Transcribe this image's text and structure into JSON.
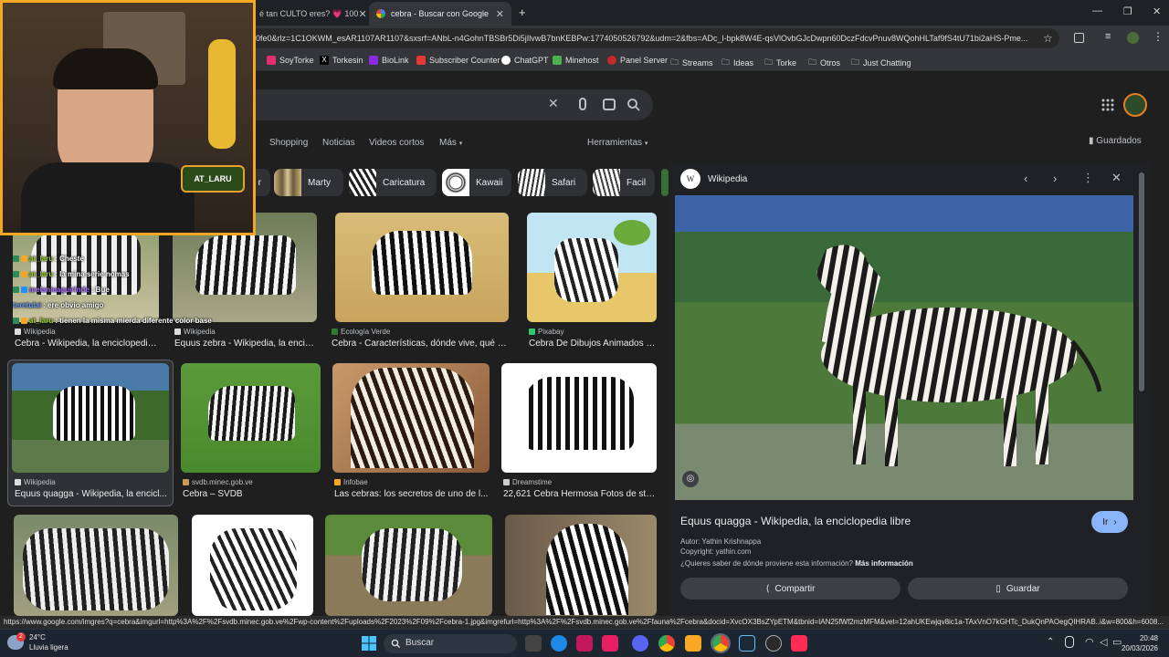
{
  "browser": {
    "tabs": [
      {
        "title": "é tan CULTO eres? 💗 100"
      },
      {
        "title": "cebra - Buscar con Google"
      }
    ],
    "new_tab_label": "+",
    "url": "0fe0&rlz=1C1OKWM_esAR1107AR1107&sxsrf=ANbL-n4GohnTBSBr5Di5jIlvwB7bnKEBPw:1774050526792&udm=2&fbs=ADc_l-bpk8W4E-qsVlOvbGJcDwpn60DczFdcvPnuv8WQohHLTaf9fS4tU71bi2aHS-Pme...",
    "bookmarks": [
      "SoyTorke",
      "Torkesin",
      "BioLink",
      "Subscriber Counter",
      "ChatGPT",
      "Minehost",
      "Panel Server",
      "Streams",
      "Ideas",
      "Torke",
      "Otros",
      "Just Chatting"
    ]
  },
  "google": {
    "filters": [
      "Shopping",
      "Noticias",
      "Videos cortos",
      "Más"
    ],
    "tools": "Herramientas",
    "saved": "Guardados",
    "chips": [
      "r",
      "Marty",
      "Caricatura",
      "Kawaii",
      "Safari",
      "Facil"
    ],
    "results": [
      {
        "source": "Wikipedia",
        "title": "Cebra - Wikipedia, la enciclopedia..."
      },
      {
        "source": "Wikipedia",
        "title": "Equus zebra - Wikipedia, la encic..."
      },
      {
        "source": "Ecología Verde",
        "title": "Cebra - Características, dónde vive, qué co..."
      },
      {
        "source": "Pixabay",
        "title": "Cebra De Dibujos Animados -..."
      },
      {
        "source": "Wikipedia",
        "title": "Equus quagga - Wikipedia, la encicl..."
      },
      {
        "source": "svdb.minec.gob.ve",
        "title": "Cebra – SVDB"
      },
      {
        "source": "Infobae",
        "title": "Las cebras: los secretos de uno de l..."
      },
      {
        "source": "Dreamstime",
        "title": "22,621 Cebra Hermosa Fotos de sto..."
      }
    ]
  },
  "panel": {
    "source": "Wikipedia",
    "title": "Equus quagga - Wikipedia, la enciclopedia libre",
    "go_label": "Ir",
    "author": "Autor: Yathin Krishnappa",
    "copyright": "Copyright: yathin.com",
    "question": "¿Quieres saber de dónde proviene esta información?",
    "more_info": "Más información",
    "share_label": "Compartir",
    "save_label": "Guardar"
  },
  "stream": {
    "cam_badge": "AT_LARU",
    "chat": [
      {
        "user": "at_laru",
        "msg": ": Cheste"
      },
      {
        "user": "at_laru",
        "msg": ": la mina serie nomas"
      },
      {
        "user": "melanieaguirlnde",
        "msg": ": Bue"
      },
      {
        "user": "teretulai",
        "msg": ": ere obvio amigo"
      },
      {
        "user": "at_laru",
        "msg": ": tienen la misma mierda diferente color base"
      }
    ]
  },
  "status_url": "https://www.google.com/imgres?q=cebra&imgurl=http%3A%2F%2Fsvdb.minec.gob.ve%2Fwp-content%2Fuploads%2F2023%2F09%2Fcebra-1.jpg&imgrefurl=http%3A%2F%2Fsvdb.minec.gob.ve%2Ffauna%2Fcebra&docid=XvcOX3BsZYpETM&tbnid=IAN25fWf2mzMFM&vet=12ahUKEwjqv8ic1a-TAxVnO7kGHTc_DukQnPAOegQIHRAB..i&w=800&h=6008...",
  "taskbar": {
    "weather_temp": "24°C",
    "weather_desc": "Lluvia ligera",
    "search_label": "Buscar",
    "time": "20:48",
    "date": "20/03/2026",
    "notification_count": "2"
  }
}
